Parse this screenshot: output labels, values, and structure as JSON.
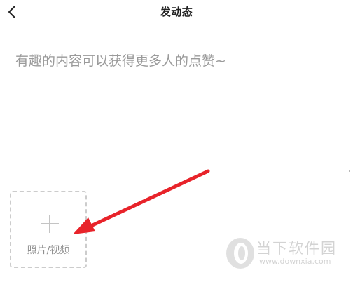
{
  "header": {
    "title": "发动态",
    "back_icon": "chevron-left-icon"
  },
  "compose": {
    "placeholder": "有趣的内容可以获得更多人的点赞~",
    "value": ""
  },
  "media_picker": {
    "icon": "plus-icon",
    "label": "照片/视频"
  },
  "annotation": {
    "arrow_color": "#e8232a"
  },
  "watermark": {
    "brand": "当下软件园",
    "url": "www.downxia.com"
  },
  "colors": {
    "title": "#222222",
    "placeholder": "#9a9a9a",
    "tile_border": "#cccccc",
    "tile_text": "#8f8f8f"
  }
}
